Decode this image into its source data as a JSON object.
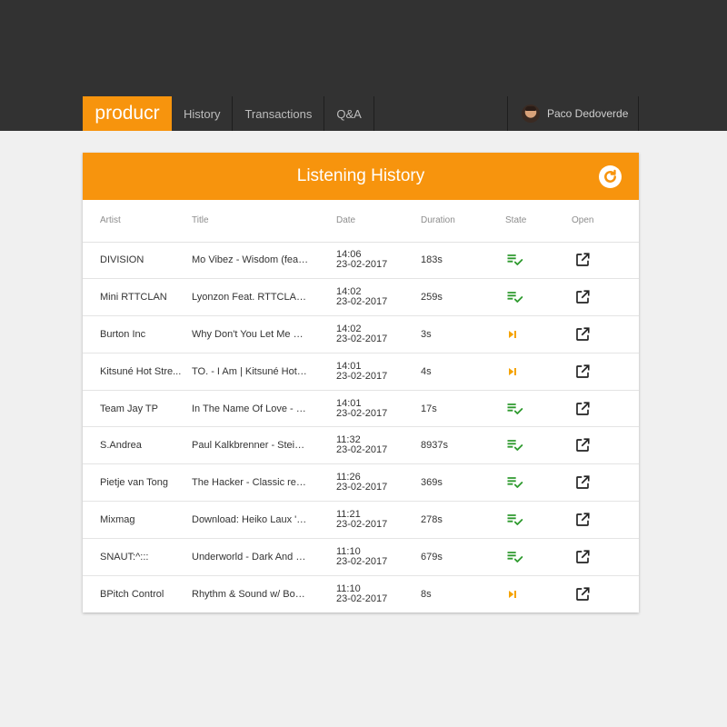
{
  "nav": {
    "brand": "producr",
    "items": [
      {
        "label": "History"
      },
      {
        "label": "Transactions"
      },
      {
        "label": "Q&A"
      }
    ],
    "user_name": "Paco Dedoverde"
  },
  "card": {
    "title": "Listening History",
    "columns": {
      "artist": "Artist",
      "title": "Title",
      "date": "Date",
      "duration": "Duration",
      "state": "State",
      "open": "Open"
    },
    "rows": [
      {
        "artist": "DIVISION",
        "title": "Mo Vibez - Wisdom (feat....",
        "time": "14:06",
        "date": "23-02-2017",
        "duration": "183s",
        "state": "check"
      },
      {
        "artist": "Mini RTTCLAN",
        "title": "Lyonzon Feat. RTTCLAN ...",
        "time": "14:02",
        "date": "23-02-2017",
        "duration": "259s",
        "state": "check"
      },
      {
        "artist": "Burton Inc",
        "title": "Why Don't You Let Me Kn...",
        "time": "14:02",
        "date": "23-02-2017",
        "duration": "3s",
        "state": "skip"
      },
      {
        "artist": "Kitsuné Hot Stre...",
        "title": "TO. - I Am | Kitsuné Hot S...",
        "time": "14:01",
        "date": "23-02-2017",
        "duration": "4s",
        "state": "skip"
      },
      {
        "artist": "Team Jay TP",
        "title": "In The Name Of Love - ( J...",
        "time": "14:01",
        "date": "23-02-2017",
        "duration": "17s",
        "state": "check"
      },
      {
        "artist": "S.Andrea",
        "title": "Paul Kalkbrenner - Steinb...",
        "time": "11:32",
        "date": "23-02-2017",
        "duration": "8937s",
        "state": "check"
      },
      {
        "artist": "Pietje van Tong",
        "title": "The Hacker - Classic revis...",
        "time": "11:26",
        "date": "23-02-2017",
        "duration": "369s",
        "state": "check"
      },
      {
        "artist": "Mixmag",
        "title": "Download: Heiko Laux 'O...",
        "time": "11:21",
        "date": "23-02-2017",
        "duration": "278s",
        "state": "check"
      },
      {
        "artist": "SNAUT:^:::",
        "title": "Underworld - Dark And Lo...",
        "time": "11:10",
        "date": "23-02-2017",
        "duration": "679s",
        "state": "check"
      },
      {
        "artist": "BPitch Control",
        "title": "Rhythm & Sound w/ Bobb...",
        "time": "11:10",
        "date": "23-02-2017",
        "duration": "8s",
        "state": "skip"
      }
    ]
  },
  "icons": {
    "refresh": "refresh-icon",
    "listened": "playlist-check-icon",
    "skipped": "skip-next-icon",
    "open": "open-in-new-icon"
  },
  "colors": {
    "accent": "#f7940d",
    "topbar": "#323232",
    "listened": "#2e9a2e",
    "skipped": "#f5a300"
  }
}
